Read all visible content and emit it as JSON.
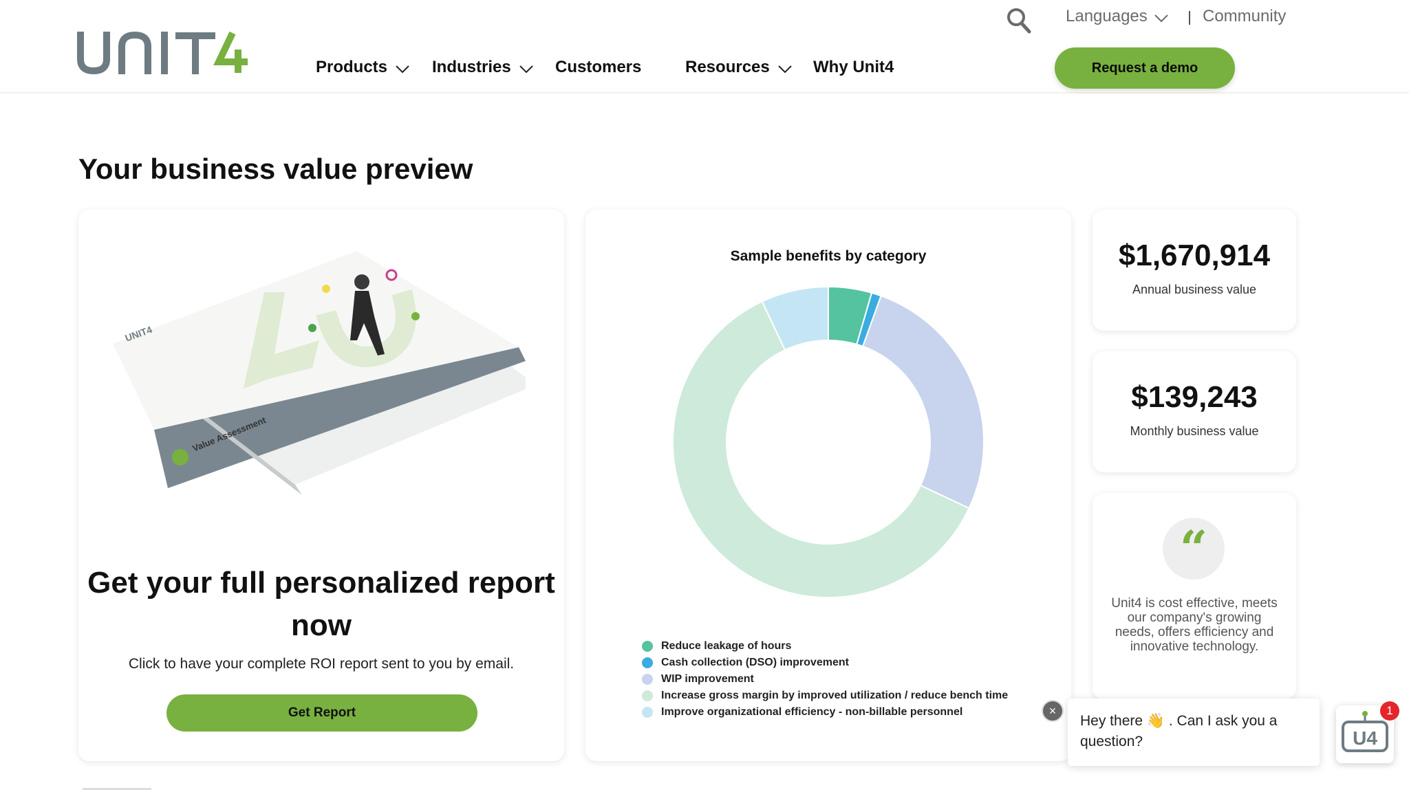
{
  "header": {
    "logo_text": "UNIT4",
    "languages_label": "Languages",
    "community_label": "Community",
    "nav": [
      {
        "label": "Products",
        "has_dropdown": true
      },
      {
        "label": "Industries",
        "has_dropdown": true
      },
      {
        "label": "Customers",
        "has_dropdown": false
      },
      {
        "label": "Resources",
        "has_dropdown": true
      },
      {
        "label": "Why Unit4",
        "has_dropdown": false
      }
    ],
    "demo_button": "Request a demo",
    "icons": [
      "search-icon",
      "chevron-down-icon"
    ]
  },
  "page": {
    "title": "Your business value preview"
  },
  "report_card": {
    "booklet_title": "Value Assessment",
    "heading": "Get your full personalized report now",
    "description": "Click to have your complete ROI report sent to you by email.",
    "button": "Get Report"
  },
  "chart_data": {
    "type": "pie",
    "title": "Sample benefits by category",
    "legend_position": "bottom",
    "series": [
      {
        "name": "Reduce leakage of hours",
        "value": 4.5,
        "color": "#55c3a0"
      },
      {
        "name": "Cash collection (DSO) improvement",
        "value": 1.0,
        "color": "#3aace0"
      },
      {
        "name": "WIP improvement",
        "value": 26.5,
        "color": "#c8d3ee"
      },
      {
        "name": "Increase gross margin by improved utilization / reduce bench time",
        "value": 61.0,
        "color": "#cdeada"
      },
      {
        "name": "Improve organizational efficiency - non-billable personnel",
        "value": 7.0,
        "color": "#c4e6f4"
      }
    ]
  },
  "stats": {
    "annual": {
      "value": "$1,670,914",
      "label": "Annual business value"
    },
    "monthly": {
      "value": "$139,243",
      "label": "Monthly business value"
    }
  },
  "quote": {
    "mark": "“",
    "text": "Unit4 is cost effective, meets our company's growing needs, offers efficiency and innovative technology."
  },
  "chat": {
    "message": "Hey there 👋 . Can I ask you a question?",
    "badge_count": "1",
    "close_symbol": "×",
    "launcher_text": "U4"
  },
  "colors": {
    "brand_green": "#78b13f",
    "logo_gray": "#6e7b82"
  }
}
